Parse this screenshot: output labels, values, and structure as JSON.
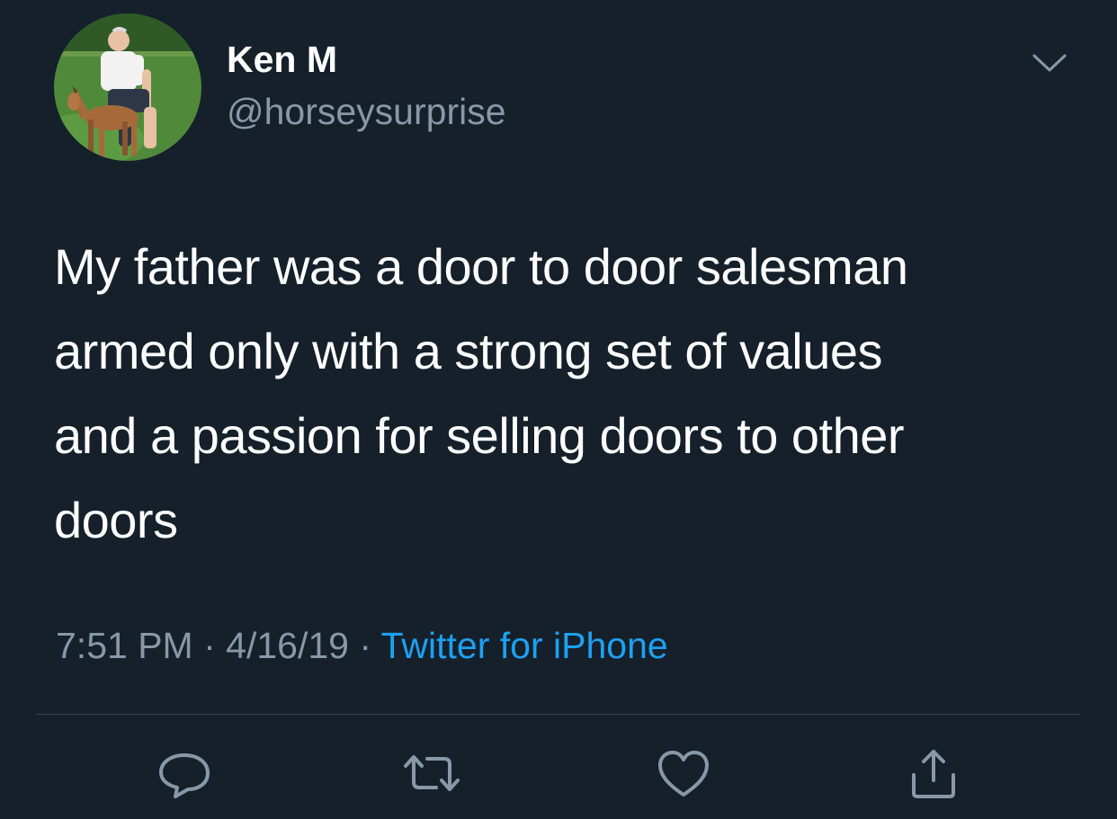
{
  "user": {
    "display_name": "Ken M",
    "handle": "@horseysurprise"
  },
  "tweet": {
    "lines": [
      "My father was a door to door salesman",
      "armed only with a strong set of values",
      "and a passion for selling doors to other",
      "doors"
    ]
  },
  "meta": {
    "time": "7:51 PM",
    "separator": " · ",
    "date": "4/16/19",
    "source": "Twitter for iPhone"
  },
  "icons": {
    "menu": "chevron-down-icon",
    "reply": "reply-icon",
    "retweet": "retweet-icon",
    "like": "heart-icon",
    "share": "share-icon"
  },
  "colors": {
    "background": "#15202b",
    "text": "#ffffff",
    "secondary_text": "#8899a6",
    "link": "#1da1f2",
    "divider": "#38444d"
  }
}
